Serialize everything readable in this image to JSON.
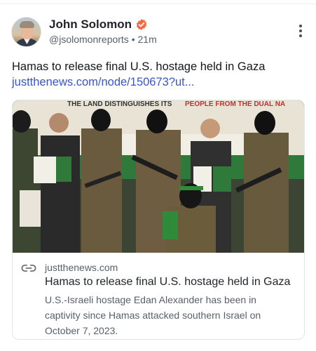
{
  "author": {
    "display_name": "John Solomon",
    "handle": "@jsolomonreports",
    "separator": "•",
    "time_ago": "21m"
  },
  "post": {
    "text": "Hamas to release final U.S. hostage held in Gaza",
    "link": "justthenews.com/node/150673?ut..."
  },
  "link_card": {
    "banner_text_dark": "THE LAND DISTINGUISHES ITS",
    "banner_text_red": "PEOPLE FROM THE DUAL NA",
    "domain": "justthenews.com",
    "title": "Hamas to release final U.S. hostage held in Gaza",
    "description": "U.S.-Israeli hostage Edan Alexander has been in captivity since Hamas attacked southern Israel on October 7, 2023."
  },
  "icons": {
    "verified": "verified-badge-icon",
    "more": "more-vertical-icon",
    "link": "link-icon"
  },
  "colors": {
    "link_blue": "#3a55c7",
    "verified_orange": "#f26a3d",
    "muted_text": "#586069"
  }
}
